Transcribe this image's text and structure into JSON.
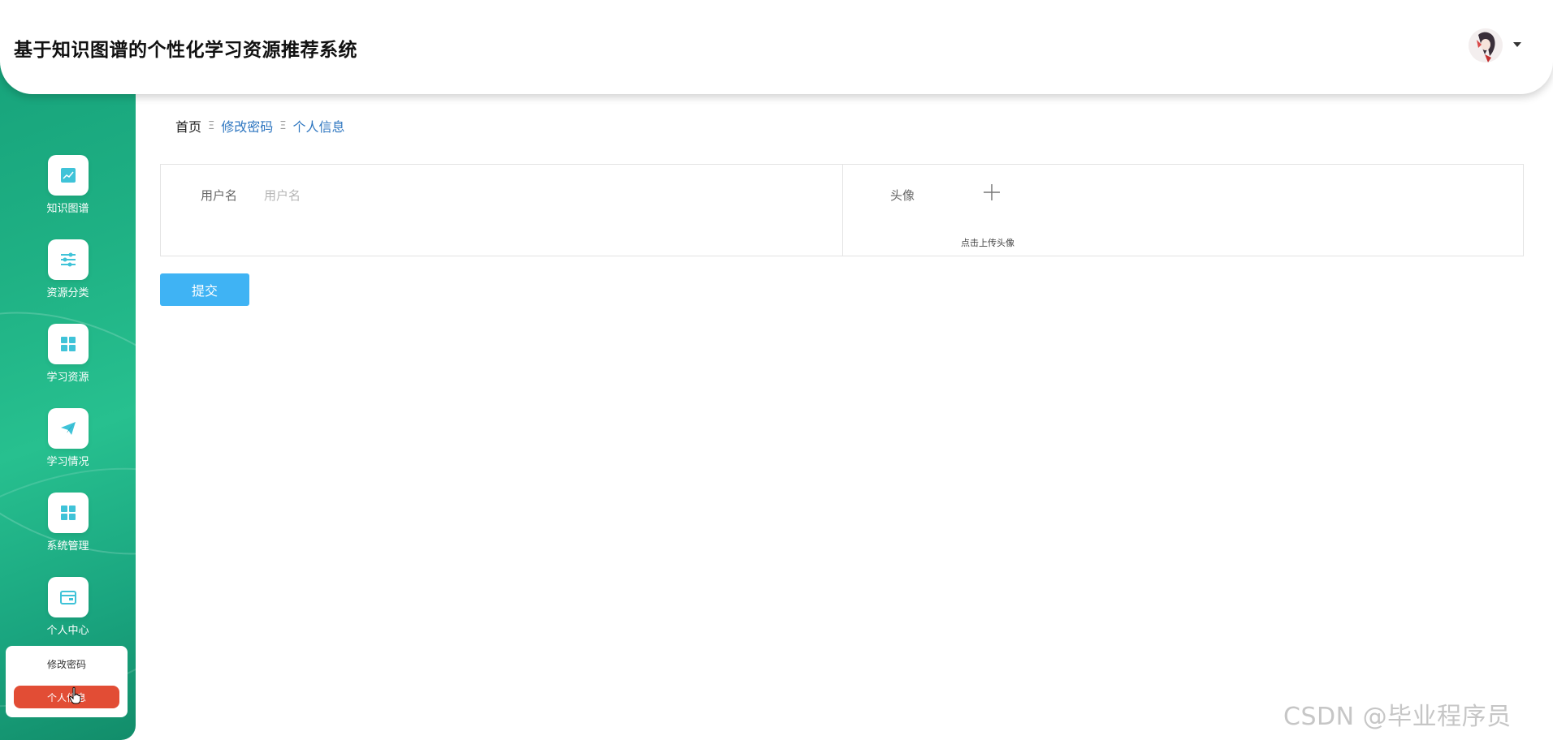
{
  "header": {
    "title": "基于知识图谱的个性化学习资源推荐系统",
    "avatar_icon": "user-avatar",
    "dropdown_icon": "caret-down-icon"
  },
  "sidebar": {
    "items": [
      {
        "label": "知识图谱",
        "icon": "chart-line-icon"
      },
      {
        "label": "资源分类",
        "icon": "sliders-icon"
      },
      {
        "label": "学习资源",
        "icon": "grid-icon"
      },
      {
        "label": "学习情况",
        "icon": "paper-plane-icon"
      },
      {
        "label": "系统管理",
        "icon": "grid-icon"
      },
      {
        "label": "个人中心",
        "icon": "wallet-icon"
      }
    ],
    "submenu": [
      {
        "label": "修改密码",
        "active": false
      },
      {
        "label": "个人信息",
        "active": true
      }
    ]
  },
  "breadcrumb": {
    "home": "首页",
    "separator": "Ξ",
    "items": [
      "修改密码",
      "个人信息"
    ]
  },
  "form": {
    "username_label": "用户名",
    "username_placeholder": "用户名",
    "avatar_label": "头像",
    "upload_hint": "点击上传头像",
    "submit_label": "提交"
  },
  "watermark": "CSDN @毕业程序员",
  "colors": {
    "sidebar_green": "#1fb184",
    "icon_accent": "#3fc3d8",
    "active_red": "#e24d35",
    "submit_blue": "#3fb3f4",
    "link_blue": "#2e76c0"
  }
}
